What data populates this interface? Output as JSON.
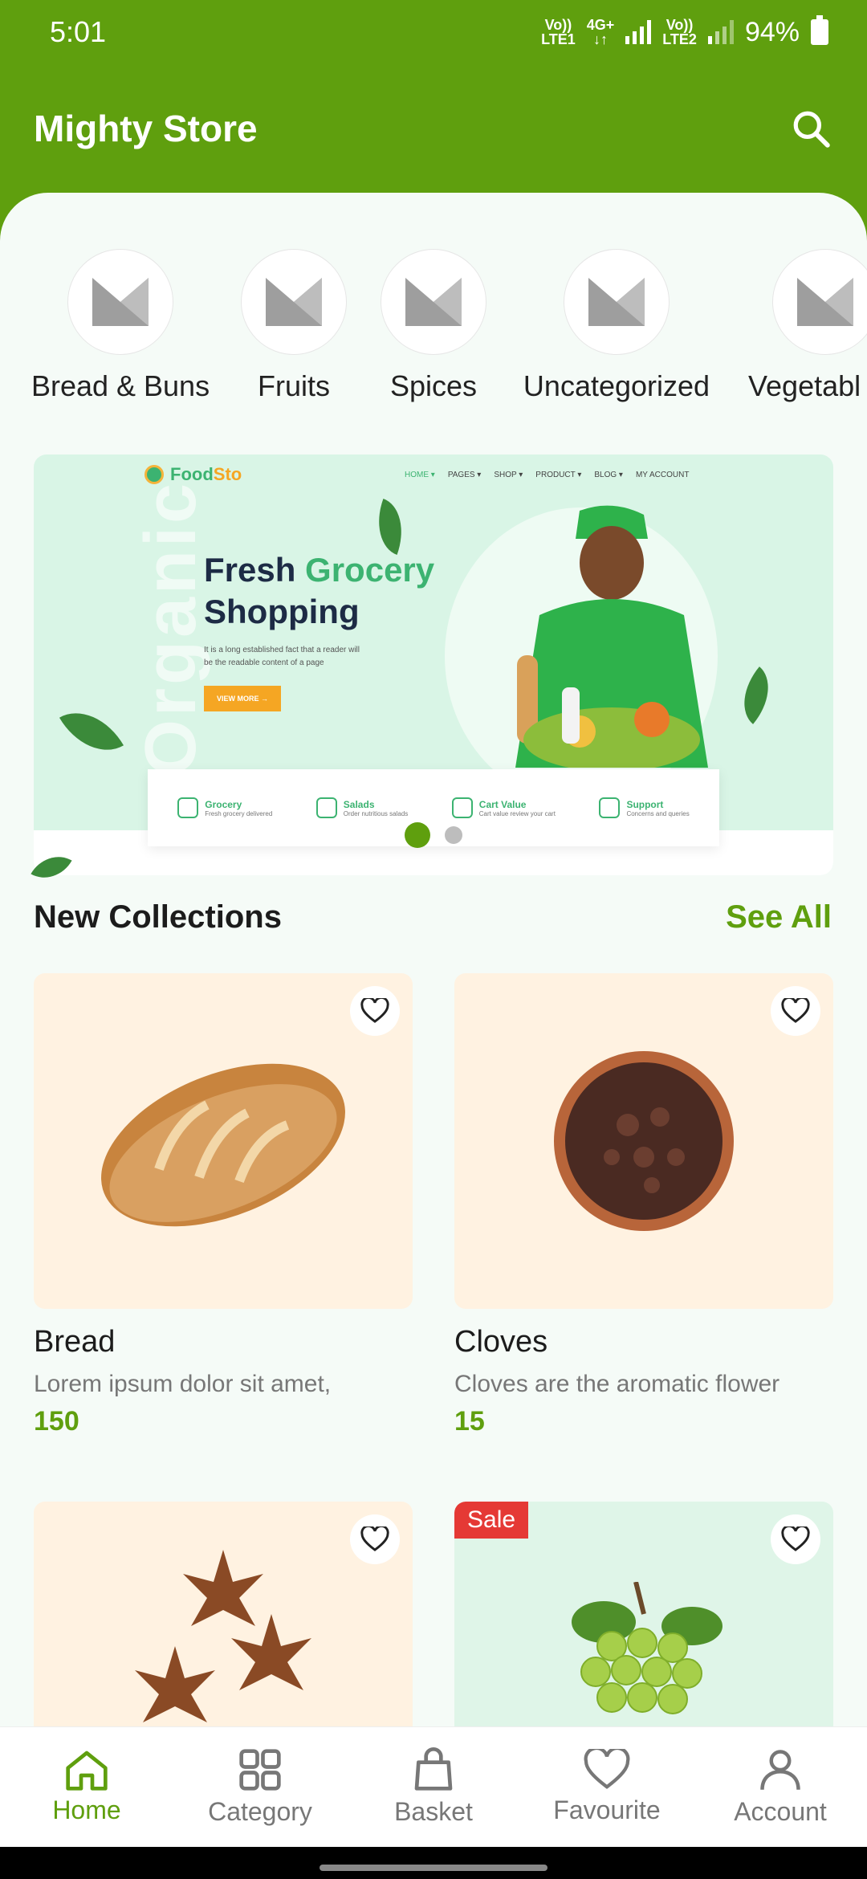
{
  "status_bar": {
    "time": "5:01",
    "net1_top": "Vo))",
    "net1_bottom": "LTE1",
    "net_type": "4G+",
    "net2_top": "Vo))",
    "net2_bottom": "LTE2",
    "battery": "94%"
  },
  "app_bar": {
    "title": "Mighty Store"
  },
  "categories": [
    {
      "label": "Bread & Buns"
    },
    {
      "label": "Fruits"
    },
    {
      "label": "Spices"
    },
    {
      "label": "Uncategorized"
    },
    {
      "label": "Vegetabl"
    }
  ],
  "banner": {
    "logo_a": "Food",
    "logo_b": "Sto",
    "nav": [
      "HOME ▾",
      "PAGES ▾",
      "SHOP ▾",
      "PRODUCT ▾",
      "BLOG ▾",
      "MY ACCOUNT"
    ],
    "watermark": "Organic",
    "headline_1a": "Fresh ",
    "headline_1b": "Grocery",
    "headline_2": "Shopping",
    "subtext": "It is a long established fact that a reader will be the readable content of a page",
    "cta": "VIEW MORE →",
    "features": [
      {
        "title": "Grocery",
        "desc": "Fresh grocery delivered"
      },
      {
        "title": "Salads",
        "desc": "Order nutritious salads"
      },
      {
        "title": "Cart Value",
        "desc": "Cart value review your cart"
      },
      {
        "title": "Support",
        "desc": "Concerns and queries"
      }
    ],
    "active_slide": 1,
    "slide_count": 2
  },
  "section": {
    "title": "New Collections",
    "see_all": "See All"
  },
  "products": [
    {
      "name": "Bread",
      "desc": "Lorem ipsum dolor sit amet,",
      "price": "150",
      "bg": "#fff2e1"
    },
    {
      "name": "Cloves",
      "desc": "Cloves are the aromatic flower",
      "price": "15",
      "bg": "#fff2e1"
    },
    {
      "name": "",
      "desc": "",
      "price": "",
      "bg": "#fff2e1"
    },
    {
      "name": "",
      "desc": "",
      "price": "",
      "bg": "#dff5e8",
      "badge": "Sale"
    }
  ],
  "bottom_nav": [
    {
      "label": "Home"
    },
    {
      "label": "Category"
    },
    {
      "label": "Basket"
    },
    {
      "label": "Favourite"
    },
    {
      "label": "Account"
    }
  ],
  "colors": {
    "primary": "#5f9f0e",
    "sale": "#e53935",
    "sheet": "#f5fbf7"
  }
}
